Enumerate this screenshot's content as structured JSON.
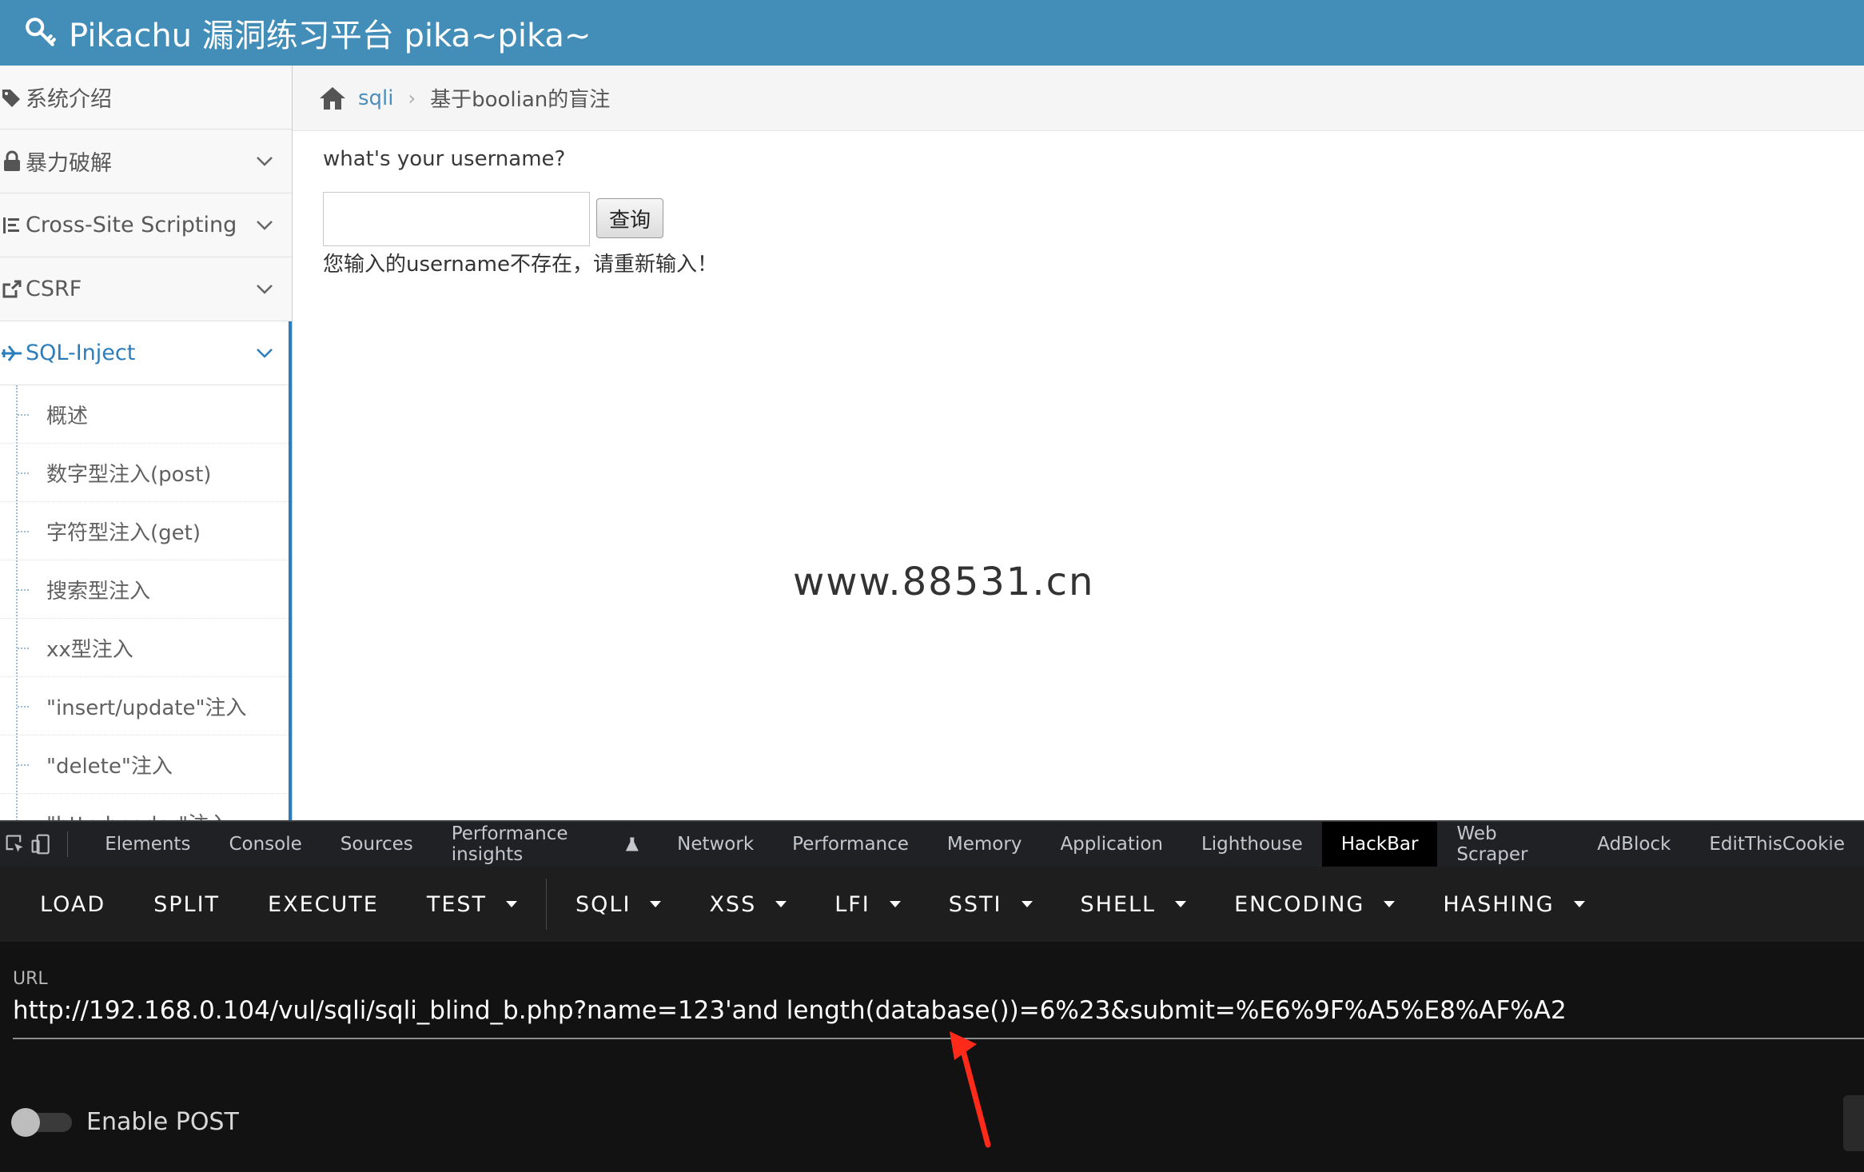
{
  "header": {
    "title": "Pikachu 漏洞练习平台 pika~pika~"
  },
  "sidebar": {
    "items": [
      {
        "label": "系统介绍"
      },
      {
        "label": "暴力破解"
      },
      {
        "label": "Cross-Site Scripting"
      },
      {
        "label": "CSRF"
      },
      {
        "label": "SQL-Inject"
      }
    ],
    "sub_items": [
      {
        "label": "概述"
      },
      {
        "label": "数字型注入(post)"
      },
      {
        "label": "字符型注入(get)"
      },
      {
        "label": "搜索型注入"
      },
      {
        "label": "xx型注入"
      },
      {
        "label": "\"insert/update\"注入"
      },
      {
        "label": "\"delete\"注入"
      },
      {
        "label": "\"http header\"注入"
      }
    ]
  },
  "breadcrumb": {
    "link": "sqli",
    "current": "基于boolian的盲注"
  },
  "main": {
    "question": "what's your username?",
    "input_value": "",
    "button": "查询",
    "message": "您输入的username不存在，请重新输入！",
    "watermark": "www.88531.cn"
  },
  "devtools": {
    "tabs": [
      "Elements",
      "Console",
      "Sources",
      "Performance insights",
      "Network",
      "Performance",
      "Memory",
      "Application",
      "Lighthouse",
      "HackBar",
      "Web Scraper",
      "AdBlock",
      "EditThisCookie"
    ],
    "active_tab": "HackBar"
  },
  "hackbar": {
    "buttons": [
      "LOAD",
      "SPLIT",
      "EXECUTE"
    ],
    "menus": [
      "TEST",
      "SQLI",
      "XSS",
      "LFI",
      "SSTI",
      "SHELL",
      "ENCODING",
      "HASHING"
    ],
    "url_label": "URL",
    "url": "http://192.168.0.104/vul/sqli/sqli_blind_b.php?name=123'and length(database())=6%23&submit=%E6%9F%A5%E8%AF%A2",
    "enable_post_label": "Enable POST",
    "enable_post": false
  },
  "colors": {
    "header_bg": "#438eb9",
    "sidebar_active": "#2b7dbc",
    "hackbar_bg": "#1e1e1e",
    "annotation_arrow": "#ff2a1a"
  }
}
